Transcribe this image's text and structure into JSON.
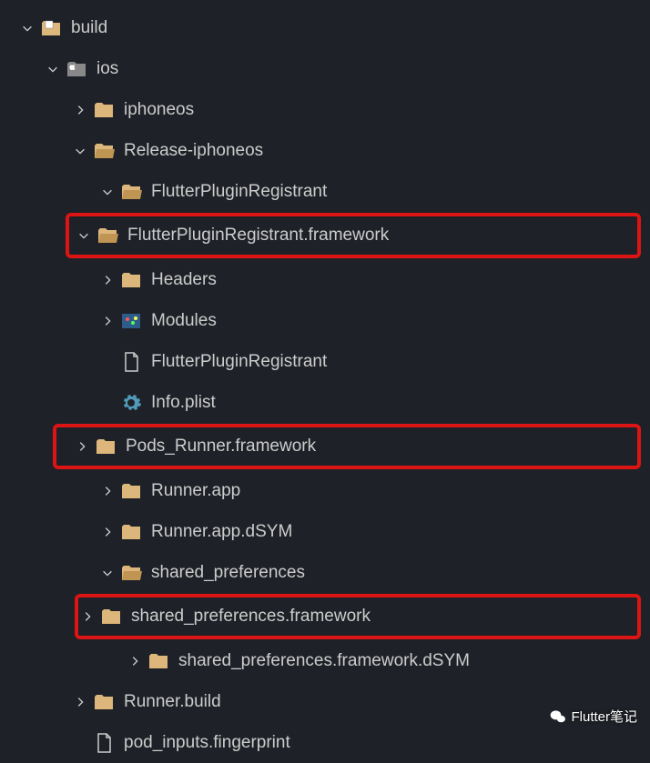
{
  "tree": {
    "build": "build",
    "ios": "ios",
    "iphoneos": "iphoneos",
    "release_iphoneos": "Release-iphoneos",
    "flutter_plugin_registrant": "FlutterPluginRegistrant",
    "flutter_plugin_registrant_fw": "FlutterPluginRegistrant.framework",
    "headers": "Headers",
    "modules": "Modules",
    "fpr_file": "FlutterPluginRegistrant",
    "info_plist": "Info.plist",
    "pods_runner_fw": "Pods_Runner.framework",
    "runner_app": "Runner.app",
    "runner_app_dsym": "Runner.app.dSYM",
    "shared_preferences": "shared_preferences",
    "shared_preferences_fw": "shared_preferences.framework",
    "shared_preferences_fw_dsym": "shared_preferences.framework.dSYM",
    "runner_build": "Runner.build",
    "pod_inputs": "pod_inputs.fingerprint"
  },
  "watermark": "Flutter笔记"
}
